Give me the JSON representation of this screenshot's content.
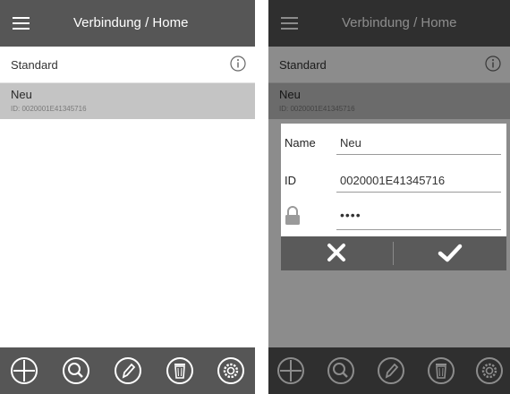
{
  "left": {
    "titlebar": {
      "title": "Verbindung / Home"
    },
    "list": {
      "items": [
        {
          "name": "Standard"
        },
        {
          "name": "Neu",
          "id_text": "ID: 0020001E41345716"
        }
      ]
    }
  },
  "right": {
    "titlebar": {
      "title": "Verbindung / Home"
    },
    "list": {
      "items": [
        {
          "name": "Standard"
        },
        {
          "name": "Neu",
          "id_text": "ID: 0020001E41345716"
        }
      ]
    },
    "dialog": {
      "name_label": "Name",
      "name_value": "Neu",
      "id_label": "ID",
      "id_value": "0020001E41345716",
      "password_value": "••••"
    }
  },
  "icons": {
    "toolbar": [
      "add-icon",
      "search-icon",
      "edit-icon",
      "delete-icon",
      "settings-icon"
    ],
    "dialog": [
      "close-icon",
      "check-icon",
      "lock-icon"
    ],
    "header": [
      "menu-icon",
      "info-icon"
    ]
  },
  "colors": {
    "bar": "#565656",
    "selected_row": "#c4c4c4"
  }
}
